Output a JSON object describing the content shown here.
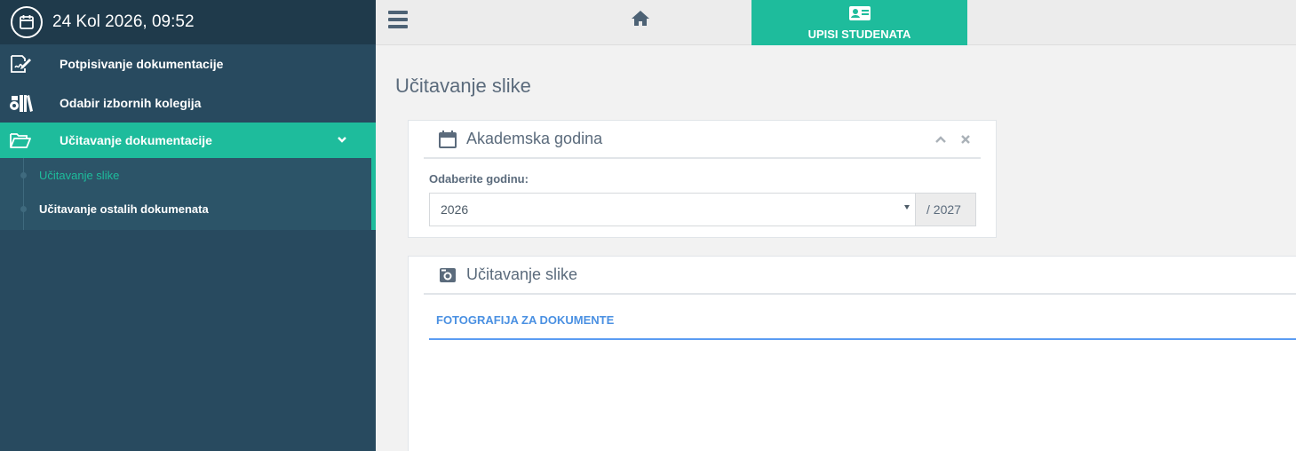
{
  "sidebar": {
    "datetime": "24 Kol 2026, 09:52",
    "items": [
      {
        "label": "Potpisivanje dokumentacije",
        "icon": "signature-icon"
      },
      {
        "label": "Odabir izbornih kolegija",
        "icon": "books-icon"
      },
      {
        "label": "Učitavanje dokumentacije",
        "icon": "folder-open-icon",
        "active": true
      }
    ],
    "submenu": [
      {
        "label": "Učitavanje slike",
        "current": true
      },
      {
        "label": "Učitavanje ostalih dokumenata"
      }
    ]
  },
  "topbar": {
    "tab_label": "UPISI STUDENATA",
    "tab_icon": "id-card-icon"
  },
  "page": {
    "title": "Učitavanje slike"
  },
  "panel_year": {
    "title": "Akademska godina",
    "field_label": "Odaberite godinu:",
    "selected_year": "2026",
    "year_suffix": "/ 2027"
  },
  "panel_upload": {
    "title": "Učitavanje slike",
    "tab_label": "FOTOGRAFIJA ZA DOKUMENTE"
  },
  "colors": {
    "sidebar_bg": "#284a5f",
    "accent": "#1ebc9c",
    "link_blue": "#4a90e2"
  }
}
